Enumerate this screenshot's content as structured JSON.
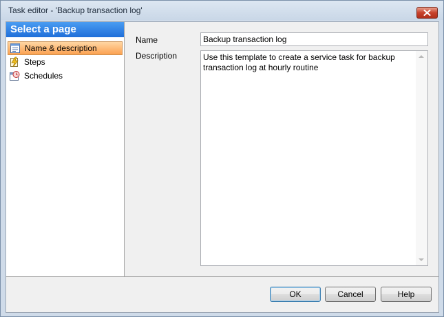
{
  "window": {
    "title": "Task editor - 'Backup transaction log'"
  },
  "sidebar": {
    "header": "Select a page",
    "items": [
      {
        "label": "Name & description",
        "icon": "name-description-icon",
        "selected": true
      },
      {
        "label": "Steps",
        "icon": "steps-icon",
        "selected": false
      },
      {
        "label": "Schedules",
        "icon": "schedules-icon",
        "selected": false
      }
    ]
  },
  "form": {
    "name_label": "Name",
    "name_value": "Backup transaction log",
    "description_label": "Description",
    "description_value": "Use this template to create a service task for backup transaction log at hourly routine"
  },
  "buttons": {
    "ok": "OK",
    "cancel": "Cancel",
    "help": "Help"
  },
  "colors": {
    "selected_item": "#fba151",
    "header_blue": "#1f6fd9",
    "close_red": "#c7412b"
  }
}
